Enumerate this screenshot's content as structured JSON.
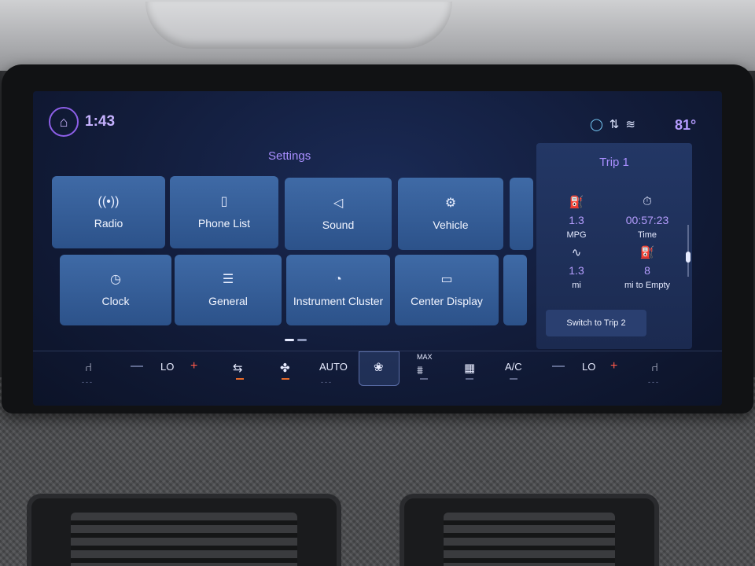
{
  "status_bar": {
    "home_icon": "home-icon",
    "time": "1:43",
    "assistant_icon": "alexa-ring-icon",
    "signal_icon": "signal-arrows-icon",
    "wifi_icon": "wifi-icon",
    "outside_temp": "81°"
  },
  "settings": {
    "title": "Settings",
    "tiles": [
      {
        "label": "Radio",
        "icon": "antenna-icon"
      },
      {
        "label": "Phone List",
        "icon": "phone-list-icon"
      },
      {
        "label": "Sound",
        "icon": "speaker-icon"
      },
      {
        "label": "Vehicle",
        "icon": "vehicle-icon"
      },
      {
        "label": "Clock",
        "icon": "clock-icon"
      },
      {
        "label": "General",
        "icon": "sliders-icon"
      },
      {
        "label": "Instrument Cluster",
        "icon": "gauge-icon"
      },
      {
        "label": "Center Display",
        "icon": "display-icon"
      }
    ],
    "page_count": 2,
    "active_page": 1
  },
  "trip": {
    "title": "Trip 1",
    "mpg_value": "1.3",
    "mpg_label": "MPG",
    "time_value": "00:57:23",
    "time_label": "Time",
    "distance_value": "1.3",
    "distance_label": "mi",
    "range_value": "8",
    "range_label": "mi to Empty",
    "switch_button": "Switch to Trip 2"
  },
  "climate": {
    "left_temp": "LO",
    "right_temp": "LO",
    "auto_label": "AUTO",
    "max_label": "MAX",
    "ac_label": "A/C",
    "minus": "—",
    "plus": "+"
  },
  "colors": {
    "accent_purple": "#a98fff",
    "tile_blue": "#3f6aa6",
    "indicator_orange": "#e66a2a"
  }
}
